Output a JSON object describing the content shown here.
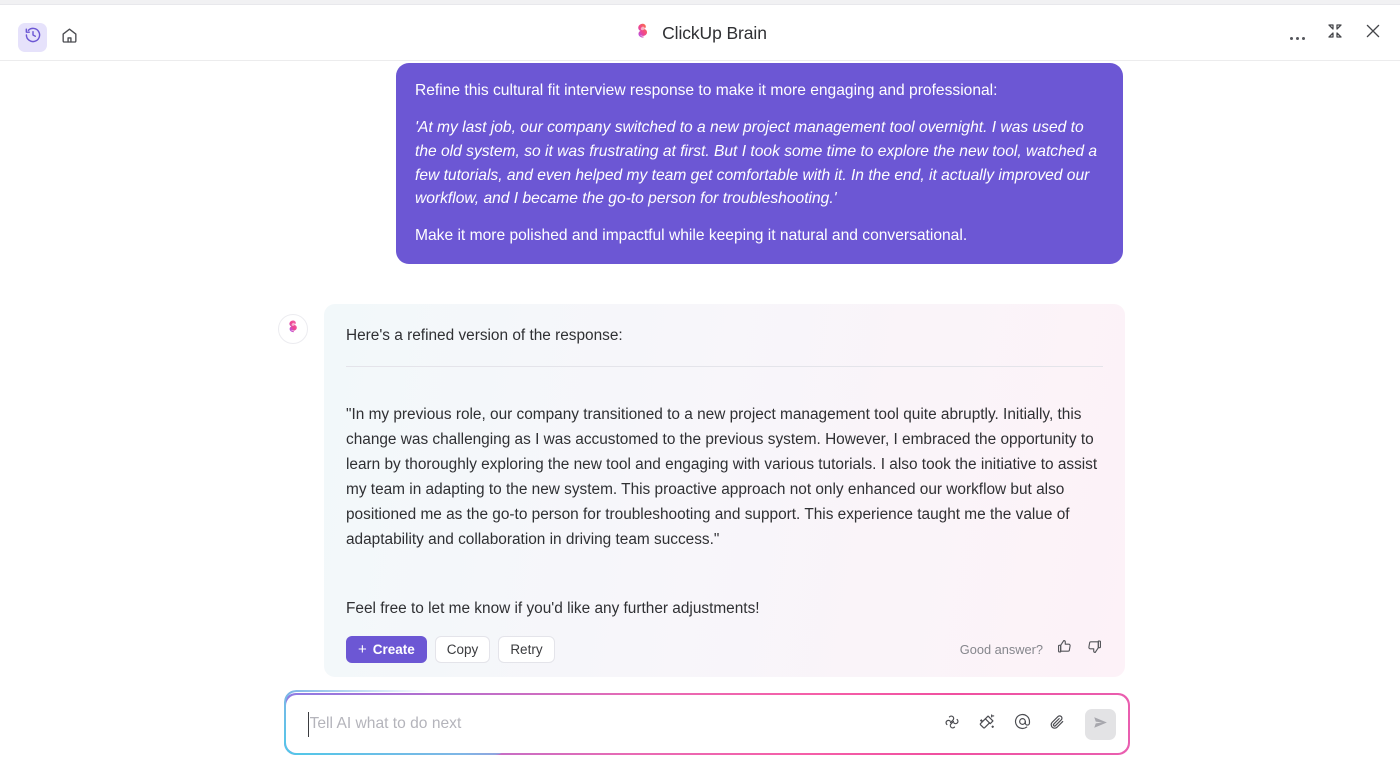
{
  "header": {
    "title": "ClickUp Brain",
    "logo_icon": "clickup-brain-logo-icon",
    "left_buttons": [
      {
        "name": "history-icon",
        "label": "History",
        "active": true
      },
      {
        "name": "home-icon",
        "label": "Home",
        "active": false
      }
    ],
    "right_buttons": [
      {
        "name": "more-options-icon",
        "label": "More options"
      },
      {
        "name": "collapse-icon",
        "label": "Collapse"
      },
      {
        "name": "close-icon",
        "label": "Close"
      }
    ]
  },
  "colors": {
    "accent_purple": "#6c57d4",
    "history_btn_bg": "#e6e2fb",
    "brand_pink": "#f050a0",
    "brand_cyan": "#4fc8e8",
    "send_btn_bg": "#e3e3e5"
  },
  "conversation": {
    "user_message": {
      "paragraphs": [
        "Refine this cultural fit interview response to make it more engaging and professional:",
        "'At my last job, our company switched to a new project management tool overnight. I was used to the old system, so it was frustrating at first. But I took some time to explore the new tool, watched a few tutorials, and even helped my team get comfortable with it. In the end, it actually improved our workflow, and I became the go-to person for troubleshooting.'",
        "Make it more polished and impactful while keeping it natural and conversational."
      ],
      "italic_index": 1
    },
    "assistant_message": {
      "avatar_icon": "clickup-brain-avatar-icon",
      "intro": "Here's a refined version of the response:",
      "body": "\"In my previous role, our company transitioned to a new project management tool quite abruptly. Initially, this change was challenging as I was accustomed to the previous system. However, I embraced the opportunity to learn by thoroughly exploring the new tool and engaging with various tutorials. I also took the initiative to assist my team in adapting to the new system. This proactive approach not only enhanced our workflow but also positioned me as the go-to person for troubleshooting and support. This experience taught me the value of adaptability and collaboration in driving team success.\"",
      "closing": "Feel free to let me know if you'd like any further adjustments!",
      "actions": {
        "create_label": "Create",
        "create_plus": "+",
        "copy_label": "Copy",
        "retry_label": "Retry",
        "feedback_label": "Good answer?",
        "thumbs_up_icon": "thumbs-up-icon",
        "thumbs_down_icon": "thumbs-down-icon"
      }
    }
  },
  "composer": {
    "placeholder": "Tell AI what to do next",
    "value": "",
    "tools": [
      {
        "name": "ai-knot-icon",
        "label": "AI tools"
      },
      {
        "name": "magic-wand-icon",
        "label": "Magic wand"
      },
      {
        "name": "mention-icon",
        "label": "Mention"
      },
      {
        "name": "attachment-icon",
        "label": "Attach file"
      }
    ],
    "send_icon": "send-icon",
    "send_label": "Send"
  }
}
